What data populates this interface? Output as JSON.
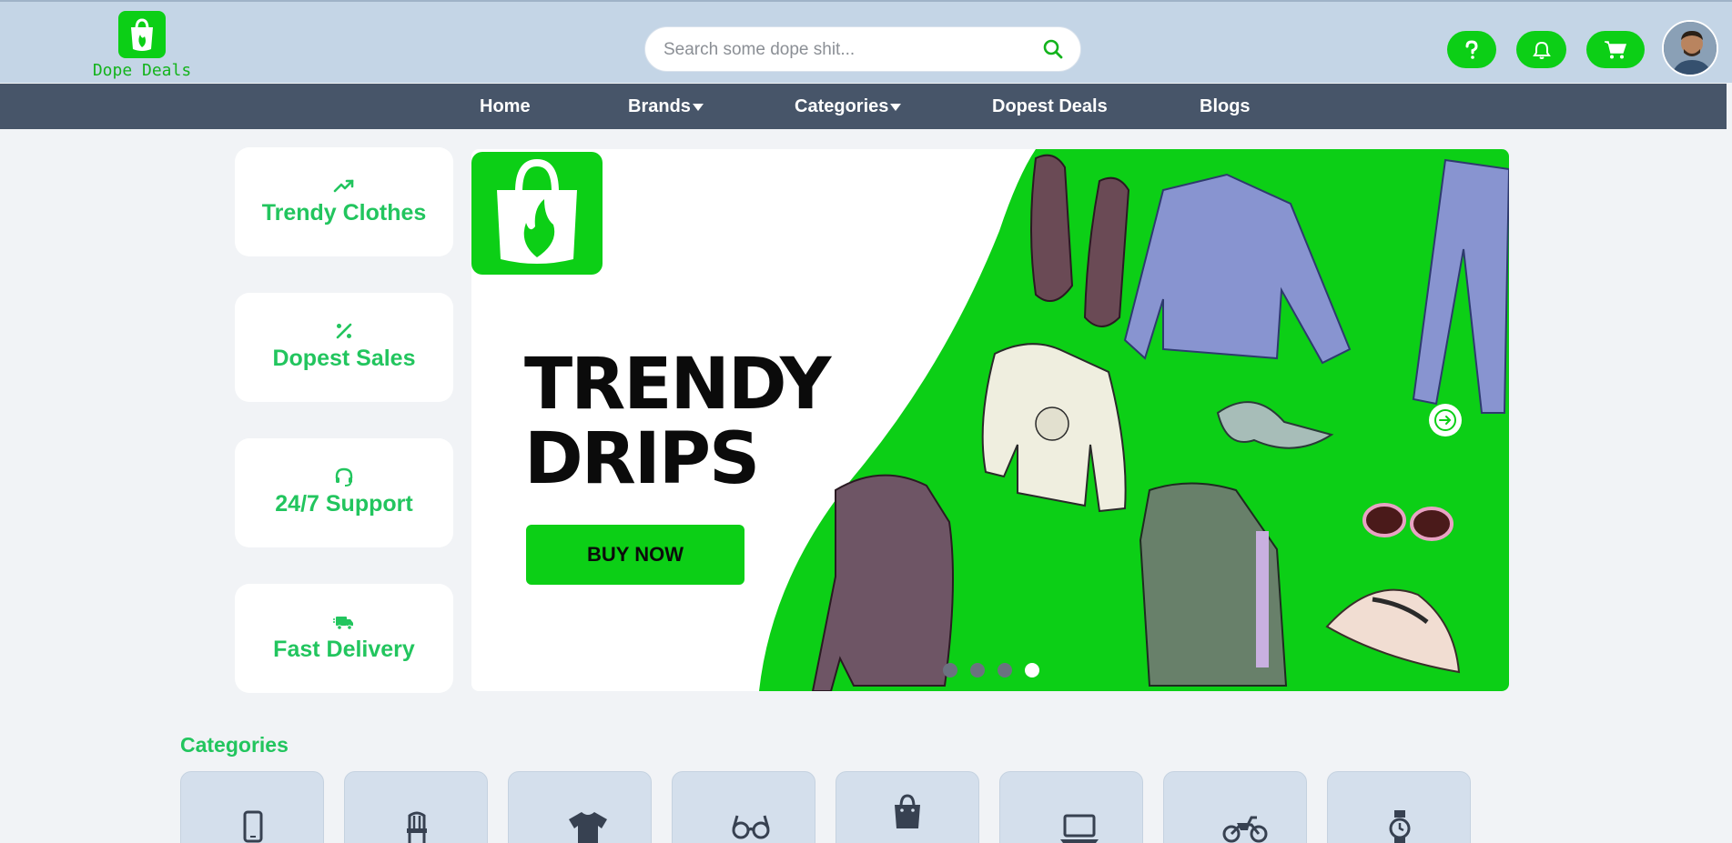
{
  "header": {
    "logo_text": "Dope Deals",
    "search_placeholder": "Search some dope shit...",
    "buttons": [
      "help",
      "notifications",
      "cart"
    ]
  },
  "nav": {
    "items": [
      {
        "label": "Home",
        "dropdown": false
      },
      {
        "label": "Brands",
        "dropdown": true
      },
      {
        "label": "Categories",
        "dropdown": true
      },
      {
        "label": "Dopest Deals",
        "dropdown": false
      },
      {
        "label": "Blogs",
        "dropdown": false
      }
    ]
  },
  "features": [
    {
      "label": "Trendy Clothes",
      "icon": "trending-up-icon"
    },
    {
      "label": "Dopest Sales",
      "icon": "percent-icon"
    },
    {
      "label": "24/7 Support",
      "icon": "headset-icon"
    },
    {
      "label": "Fast Delivery",
      "icon": "truck-icon"
    }
  ],
  "banner": {
    "headline_line1": "TRENDY",
    "headline_line2": "DRIPS",
    "cta": "BUY NOW",
    "slide_count": 4,
    "active_slide": 4
  },
  "categories": {
    "title": "Categories",
    "icons": [
      "phone-icon",
      "chair-icon",
      "tshirt-icon",
      "glasses-icon",
      "bag-icon",
      "laptop-icon",
      "motorcycle-icon",
      "watch-icon"
    ]
  },
  "colors": {
    "accent": "#0ccf16",
    "accent_text": "#22c55e",
    "header_bg": "#c4d5e6",
    "nav_bg": "#475569",
    "page_bg": "#f1f3f6"
  }
}
